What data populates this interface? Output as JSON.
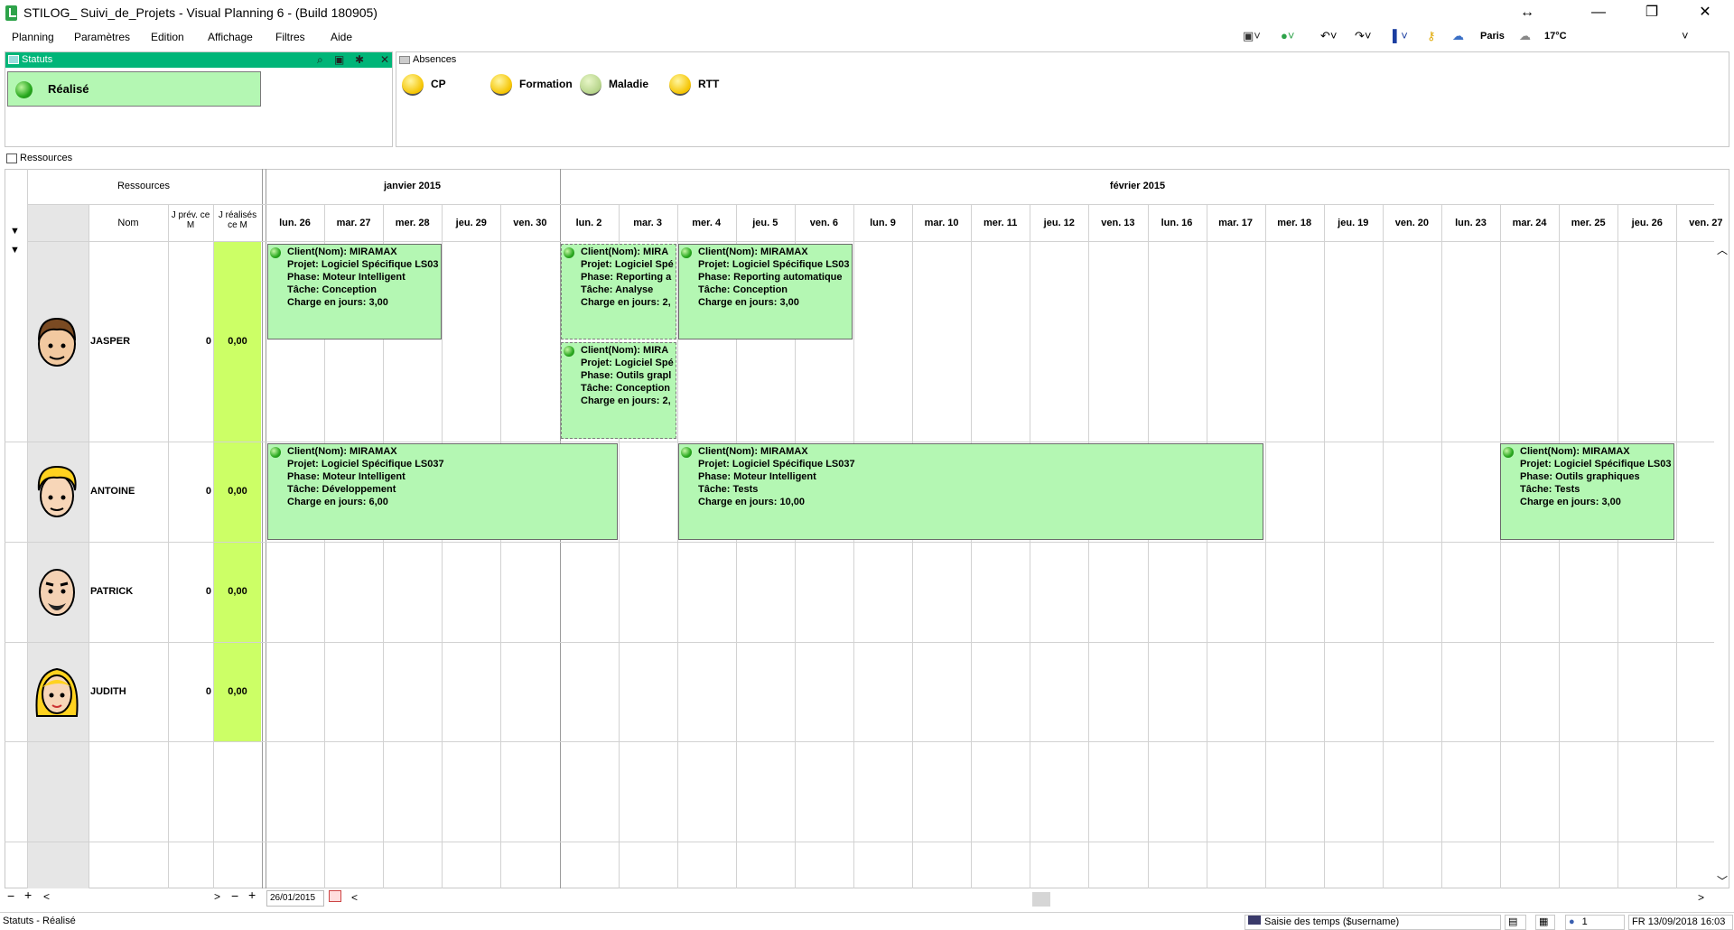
{
  "window": {
    "title": "STILOG_ Suivi_de_Projets - Visual Planning 6 - (Build 180905)"
  },
  "menu": [
    "Planning",
    "Paramètres",
    "Edition",
    "Affichage",
    "Filtres",
    "Aide"
  ],
  "toolbar": {
    "city": "Paris",
    "temperature": "17°C"
  },
  "statuts_panel": {
    "title": "Statuts",
    "status_label": "Réalisé",
    "status_color": "#b4f7b3"
  },
  "absences_panel": {
    "title": "Absences",
    "items": [
      "CP",
      "Formation",
      "Maladie",
      "RTT"
    ]
  },
  "ressources_tab": {
    "label": "Ressources"
  },
  "grid": {
    "left_header": "Ressources",
    "columns": {
      "nom": "Nom",
      "prev": "J prév. ce M",
      "realises": "J réalisés ce M"
    },
    "months": [
      "janvier 2015",
      "février 2015"
    ],
    "days": [
      "lun. 26",
      "mar. 27",
      "mer. 28",
      "jeu. 29",
      "ven. 30",
      "lun. 2",
      "mar. 3",
      "mer. 4",
      "jeu. 5",
      "ven. 6",
      "lun. 9",
      "mar. 10",
      "mer. 11",
      "jeu. 12",
      "ven. 13",
      "lun. 16",
      "mar. 17",
      "mer. 18",
      "jeu. 19",
      "ven. 20",
      "lun. 23",
      "mar. 24",
      "mer. 25",
      "jeu. 26",
      "ven. 27"
    ],
    "resources": [
      {
        "name": "JASPER",
        "prev": "0",
        "real": "0,00"
      },
      {
        "name": "ANTOINE",
        "prev": "0",
        "real": "0,00"
      },
      {
        "name": "PATRICK",
        "prev": "0",
        "real": "0,00"
      },
      {
        "name": "JUDITH",
        "prev": "0",
        "real": "0,00"
      }
    ],
    "real_column_color": "#ccff66",
    "tasks": [
      {
        "lines": [
          "Client(Nom): MIRAMAX",
          "Projet: Logiciel Spécifique LS03",
          "Phase: Moteur Intelligent",
          "Tâche: Conception",
          "Charge en jours: 3,00"
        ]
      },
      {
        "lines": [
          "Client(Nom): MIRA",
          "Projet: Logiciel Spé",
          "Phase: Reporting a",
          "Tâche: Analyse",
          "Charge en jours: 2,"
        ]
      },
      {
        "lines": [
          "Client(Nom): MIRAMAX",
          "Projet: Logiciel Spécifique LS03",
          "Phase: Reporting automatique",
          "Tâche: Conception",
          "Charge en jours: 3,00"
        ]
      },
      {
        "lines": [
          "Client(Nom): MIRA",
          "Projet: Logiciel Spé",
          "Phase: Outils grapl",
          "Tâche: Conception",
          "Charge en jours: 2,"
        ]
      },
      {
        "lines": [
          "Client(Nom): MIRAMAX",
          "Projet: Logiciel Spécifique LS037",
          "Phase: Moteur Intelligent",
          "Tâche: Développement",
          "Charge en jours: 6,00"
        ]
      },
      {
        "lines": [
          "Client(Nom): MIRAMAX",
          "Projet: Logiciel Spécifique LS037",
          "Phase: Moteur Intelligent",
          "Tâche: Tests",
          "Charge en jours: 10,00"
        ]
      },
      {
        "lines": [
          "Client(Nom): MIRAMAX",
          "Projet: Logiciel Spécifique LS03",
          "Phase: Outils graphiques",
          "Tâche: Tests",
          "Charge en jours: 3,00"
        ]
      }
    ],
    "date_field": "26/01/2015"
  },
  "statusbar": {
    "left": "Statuts - Réalisé",
    "saisie": "Saisie des temps ($username)",
    "users": "1",
    "locale_date": "FR 13/09/2018 16:03"
  }
}
